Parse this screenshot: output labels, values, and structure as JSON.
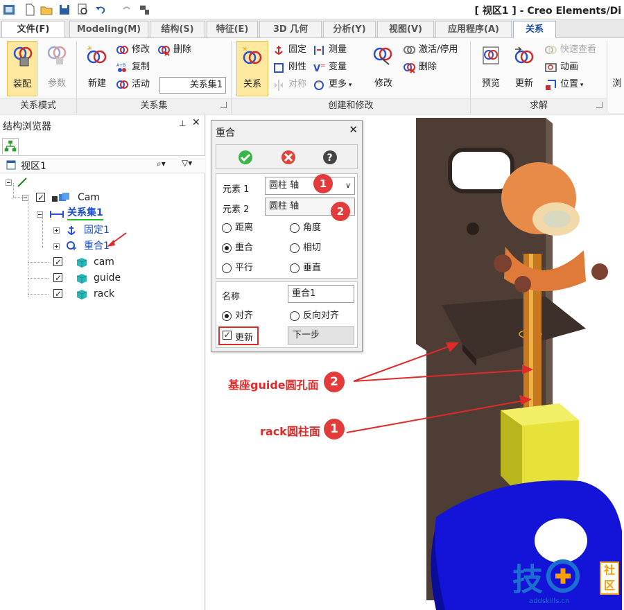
{
  "window": {
    "title": "[ 视区1 ] - Creo Elements/Di"
  },
  "tabs": [
    {
      "label": "文件(F)"
    },
    {
      "label": "Modeling(M)"
    },
    {
      "label": "结构(S)"
    },
    {
      "label": "特征(E)"
    },
    {
      "label": "3D 几何"
    },
    {
      "label": "分析(Y)"
    },
    {
      "label": "视图(V)"
    },
    {
      "label": "应用程序(A)"
    },
    {
      "label": "关系"
    }
  ],
  "ribbon": {
    "mode_group": {
      "label": "关系模式",
      "assemble": "装配",
      "params": "参数"
    },
    "set_group": {
      "label": "关系集",
      "new": "新建",
      "modify": "修改",
      "delete": "删除",
      "copy": "复制",
      "active": "活动",
      "set_name": "关系集1"
    },
    "create_group": {
      "label": "创建和修改",
      "relation": "关系",
      "fix": "固定",
      "rigid": "刚性",
      "symmetry": "对称",
      "measure": "测量",
      "variable": "变量",
      "more": "更多",
      "modify": "修改",
      "activate": "激活/停用",
      "delete": "删除"
    },
    "solve_group": {
      "label": "求解",
      "preview": "预览",
      "update": "更新",
      "quick_view": "快速查看",
      "animation": "动画",
      "position": "位置",
      "more_cut": "浏"
    }
  },
  "browser": {
    "title": "结构浏览器",
    "pin": "ᵖ",
    "view_label": "视区1",
    "root": "Cam",
    "relset": "关系集1",
    "fix": "固定1",
    "coincident": "重合1",
    "parts": [
      "cam",
      "guide",
      "rack"
    ]
  },
  "dialog": {
    "title": "重合",
    "element1_label": "元素 1",
    "element1_value": "圆柱 轴",
    "element2_label": "元素 2",
    "element2_value": "圆柱 轴",
    "options": {
      "distance": "距离",
      "angle": "角度",
      "coincident": "重合",
      "tangent": "相切",
      "parallel": "平行",
      "perpendicular": "垂直"
    },
    "selected_option": "coincident",
    "name_label": "名称",
    "name_value": "重合1",
    "align": "对齐",
    "reverse_align": "反向对齐",
    "update": "更新",
    "next": "下一步"
  },
  "callouts": {
    "n1": "1",
    "n2": "2",
    "hole_face": "基座guide圆孔面",
    "cyl_face": "rack圆柱面"
  },
  "watermark": {
    "text": "addskills.cn",
    "logo_a": "技",
    "logo_b": "社",
    "logo_c": "区"
  },
  "colors": {
    "accent": "#1a4fa0",
    "callout": "#e02a2a",
    "pressed": "#fde8a0",
    "guide": "#4b3a32",
    "rack": "#e6e23a",
    "cam": "#1010d8",
    "figure": "#e88a48"
  }
}
